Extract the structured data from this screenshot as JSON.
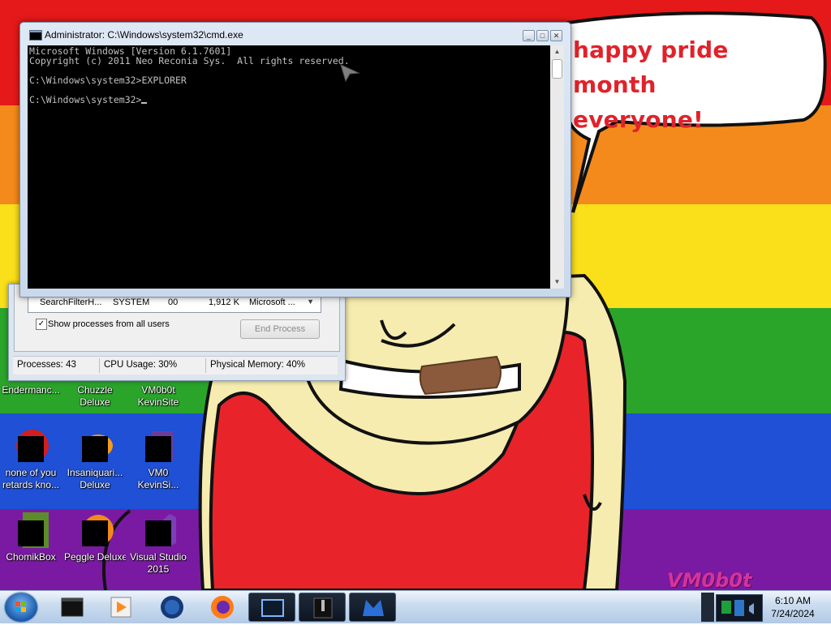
{
  "wallpaper": {
    "speech_bubble": {
      "line1": "happy pride month",
      "line2": "everyone!"
    },
    "watermark": "VM0b0t"
  },
  "desktop_icons": [
    {
      "label": "Endermanc...",
      "row": 0,
      "col": 0
    },
    {
      "label": "Chuzzle Deluxe",
      "row": 0,
      "col": 1
    },
    {
      "label": "VM0b0t KevinSite",
      "row": 0,
      "col": 2
    },
    {
      "label": "none of you retards kno...",
      "row": 1,
      "col": 0
    },
    {
      "label": "Insaniquari... Deluxe",
      "row": 1,
      "col": 1
    },
    {
      "label": "VM0 KevinSi...",
      "row": 1,
      "col": 2
    },
    {
      "label": "ChomikBox",
      "row": 2,
      "col": 0
    },
    {
      "label": "Peggle Deluxe",
      "row": 2,
      "col": 1
    },
    {
      "label": "Visual Studio 2015",
      "row": 2,
      "col": 2
    }
  ],
  "task_manager": {
    "row": {
      "name": "SearchFilterH...",
      "user": "SYSTEM",
      "cpu": "00",
      "memory": "1,912 K",
      "description": "Microsoft ..."
    },
    "show_all_label": "Show processes from all users",
    "show_all_checked": true,
    "end_process_label": "End Process",
    "status": {
      "processes": "Processes: 43",
      "cpu": "CPU Usage: 30%",
      "memory": "Physical Memory: 40%"
    }
  },
  "cmd": {
    "title": "Administrator: C:\\Windows\\system32\\cmd.exe",
    "lines": [
      "Microsoft Windows [Version 6.1.7601]",
      "Copyright (c) 2011 Neo Reconia Sys.  All rights reserved.",
      "",
      "C:\\Windows\\system32>EXPLORER",
      "",
      "C:\\Windows\\system32>"
    ],
    "buttons": {
      "minimize": "_",
      "maximize": "□",
      "close": "✕"
    }
  },
  "taskbar": {
    "pinned": [
      {
        "name": "cmd-taskbar-button"
      },
      {
        "name": "media-player-taskbar-button"
      },
      {
        "name": "globe-taskbar-button"
      },
      {
        "name": "firefox-taskbar-button"
      },
      {
        "name": "window-taskbar-button"
      },
      {
        "name": "dark-app-taskbar-button"
      },
      {
        "name": "malwarebytes-taskbar-button"
      }
    ],
    "clock": {
      "time": "6:10 AM",
      "date": "7/24/2024"
    }
  },
  "colors": {
    "pride_red": "#e51919",
    "pride_orange": "#f58a1c",
    "pride_yellow": "#fae01b",
    "pride_green": "#2aa52a",
    "pride_blue": "#1f50d6",
    "pride_purple": "#7a1aa2",
    "bubble_text": "#e0222a",
    "console_bg": "#000000",
    "console_fg": "#c0c0c0"
  }
}
